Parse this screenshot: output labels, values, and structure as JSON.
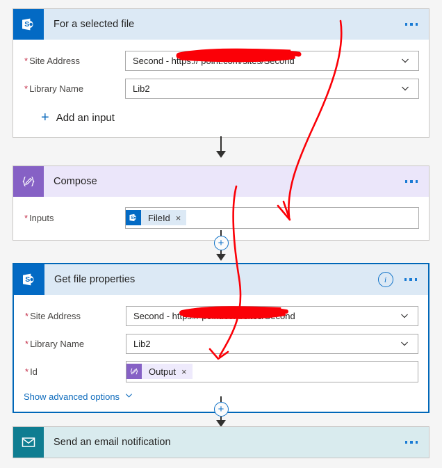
{
  "flow": {
    "steps": [
      {
        "id": "trigger",
        "title": "For a selected file",
        "icon": "sharepoint-icon",
        "header_color": "#dce9f5",
        "icon_color": "#036ac4",
        "selected": false,
        "has_info": false,
        "fields": [
          {
            "label": "Site Address",
            "required": true,
            "value": "Second - https://             point.com/sites/Second",
            "control": "dropdown",
            "redacted": true
          },
          {
            "label": "Library Name",
            "required": true,
            "value": "Lib2",
            "control": "dropdown",
            "redacted": false
          }
        ],
        "add_input_label": "Add an input"
      },
      {
        "id": "compose",
        "title": "Compose",
        "icon": "compose-braces-icon",
        "header_color": "#ebe6fa",
        "icon_color": "#8661c5",
        "selected": false,
        "has_info": false,
        "fields": [
          {
            "label": "Inputs",
            "required": true,
            "control": "token",
            "token": {
              "text": "FileId",
              "icon": "sharepoint-icon",
              "remove_label": "×",
              "kind": "sp"
            }
          }
        ]
      },
      {
        "id": "get-file-properties",
        "title": "Get file properties",
        "icon": "sharepoint-icon",
        "header_color": "#dce9f5",
        "icon_color": "#036ac4",
        "selected": true,
        "has_info": true,
        "info_label": "i",
        "fields": [
          {
            "label": "Site Address",
            "required": true,
            "value": "Second - https://             point.com/sites/Second",
            "control": "dropdown",
            "redacted": true
          },
          {
            "label": "Library Name",
            "required": true,
            "value": "Lib2",
            "control": "dropdown",
            "redacted": false
          },
          {
            "label": "Id",
            "required": true,
            "control": "token",
            "token": {
              "text": "Output",
              "icon": "compose-braces-icon",
              "remove_label": "×",
              "kind": "compose"
            }
          }
        ],
        "advanced_link": "Show advanced options"
      },
      {
        "id": "send-email",
        "title": "Send an email notification",
        "icon": "envelope-icon",
        "header_color": "#d9ebee",
        "icon_color": "#0f7d91",
        "selected": false,
        "has_info": false
      }
    ],
    "connectors": [
      {
        "type": "arrow"
      },
      {
        "type": "plus-arrow",
        "plus_label": "+"
      },
      {
        "type": "plus-arrow",
        "plus_label": "+"
      }
    ]
  },
  "annotations": {
    "ink_color": "#fb0007",
    "marks": [
      {
        "name": "arrow-to-compose-inputs"
      },
      {
        "name": "arrow-to-get-file-properties-id"
      },
      {
        "name": "redaction-scribble-trigger-site-address"
      },
      {
        "name": "redaction-scribble-get-file-site-address"
      }
    ]
  },
  "colors": {
    "background": "#f5f5f5",
    "accent_blue": "#0f6cbd",
    "selected_border": "#0067b8",
    "required_asterisk": "#c4314b"
  }
}
